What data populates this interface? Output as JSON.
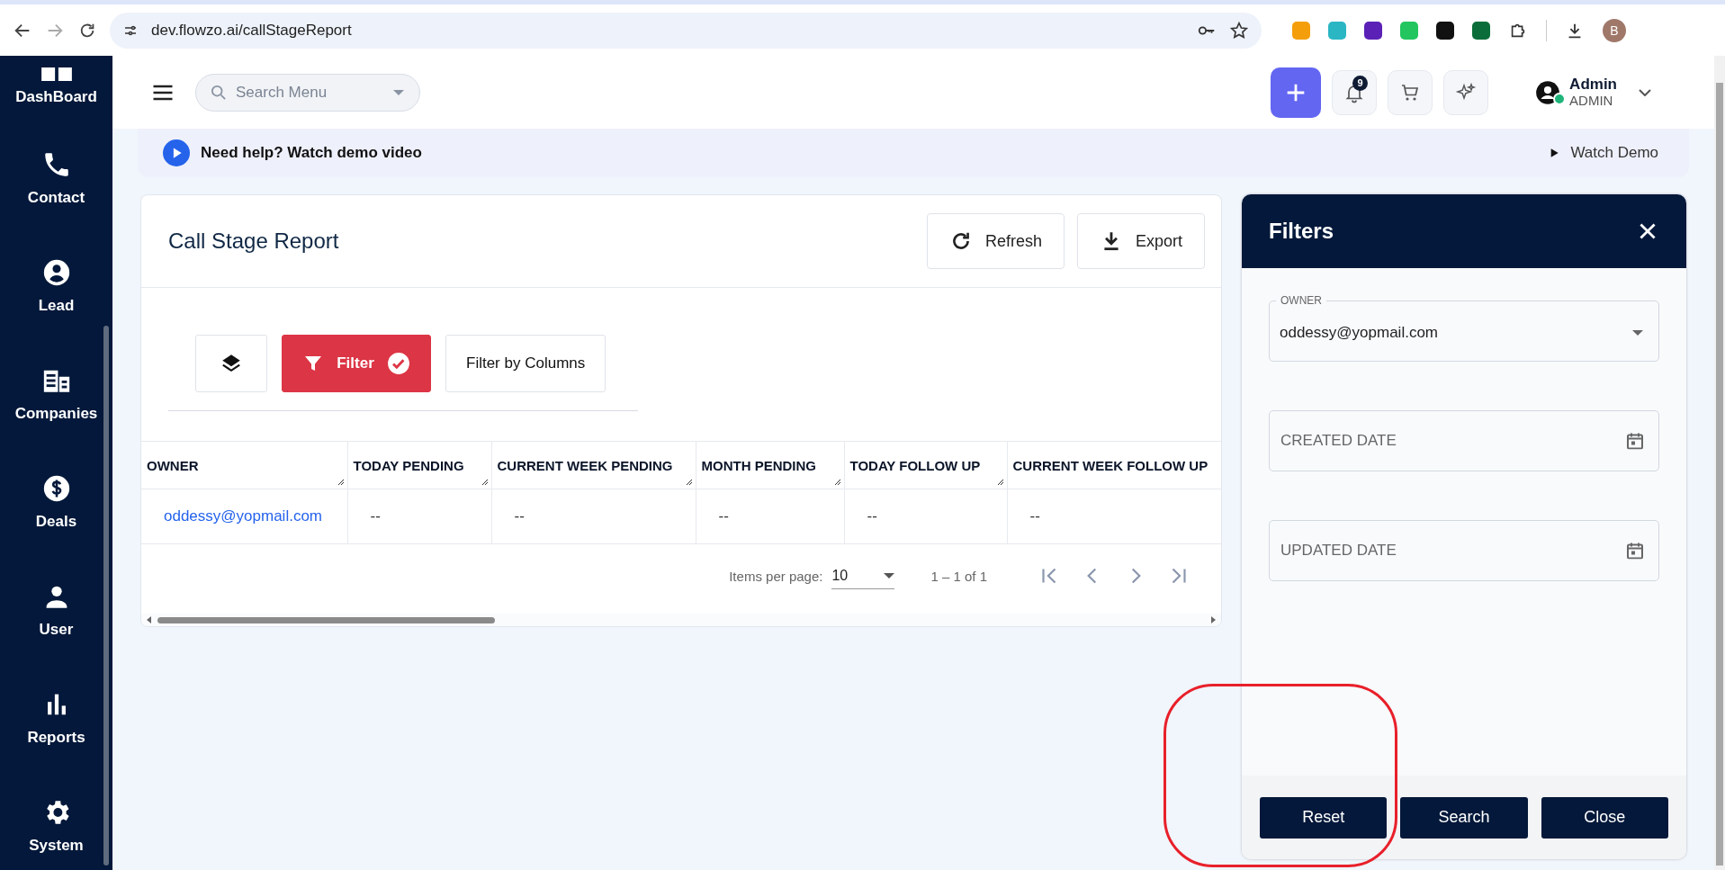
{
  "browser": {
    "url": "dev.flowzo.ai/callStageReport",
    "profile_initial": "B"
  },
  "sidebar": {
    "items": [
      {
        "label": "DashBoard"
      },
      {
        "label": "Contact"
      },
      {
        "label": "Lead"
      },
      {
        "label": "Companies"
      },
      {
        "label": "Deals"
      },
      {
        "label": "User"
      },
      {
        "label": "Reports"
      },
      {
        "label": "System"
      }
    ]
  },
  "header": {
    "search": {
      "placeholder": "Search Menu"
    },
    "notification_count": "9",
    "user": {
      "name": "Admin",
      "role": "ADMIN"
    }
  },
  "help_banner": {
    "text": "Need help? Watch demo video",
    "link": "Watch Demo"
  },
  "report": {
    "title": "Call Stage Report",
    "buttons": [
      "Refresh",
      "Export"
    ],
    "toolbar": {
      "filter_label": "Filter",
      "filter_active": true,
      "columns_label": "Filter by Columns"
    },
    "table": {
      "columns": [
        "OWNER",
        "TODAY PENDING",
        "CURRENT WEEK PENDING",
        "MONTH PENDING",
        "TODAY FOLLOW UP",
        "CURRENT WEEK FOLLOW UP"
      ],
      "rows": [
        {
          "cells": [
            "oddessy@yopmail.com",
            "--",
            "--",
            "--",
            "--",
            "--"
          ]
        }
      ]
    },
    "pagination": {
      "label": "Items per page:",
      "page_size": "10",
      "range": "1 – 1 of 1"
    }
  },
  "filters": {
    "title": "Filters",
    "fields": [
      {
        "kind": "select",
        "label": "OWNER",
        "value": "oddessy@yopmail.com"
      },
      {
        "kind": "date",
        "placeholder": "CREATED DATE"
      },
      {
        "kind": "date",
        "placeholder": "UPDATED DATE"
      }
    ],
    "buttons": [
      "Reset",
      "Search",
      "Close"
    ]
  }
}
